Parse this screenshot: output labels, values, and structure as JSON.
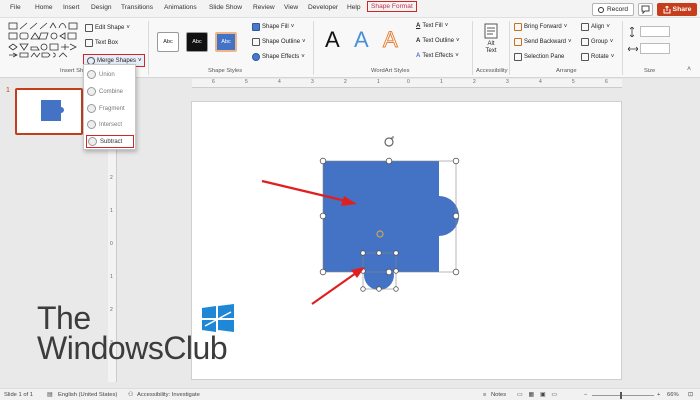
{
  "menubar": {
    "tabs": [
      "File",
      "Home",
      "Insert",
      "Design",
      "Transitions",
      "Animations",
      "Slide Show",
      "Review",
      "View",
      "Developer",
      "Help",
      "Shape Format"
    ],
    "active_tab": "Shape Format",
    "record_label": "Record",
    "share_label": "Share"
  },
  "ribbon": {
    "insert_shapes": {
      "edit_shape": "Edit Shape",
      "text_box": "Text Box",
      "merge_shapes": "Merge Shapes",
      "group_label": "Insert Sha"
    },
    "shape_styles": {
      "swatch_text": "Abc",
      "shape_fill": "Shape Fill",
      "shape_outline": "Shape Outline",
      "shape_effects": "Shape Effects",
      "group_label": "Shape Styles"
    },
    "wordart": {
      "glyph": "A",
      "text_fill": "Text Fill",
      "text_outline": "Text Outline",
      "text_effects": "Text Effects",
      "group_label": "WordArt Styles"
    },
    "accessibility": {
      "alt_text": "Alt Text",
      "group_label": "Accessibility"
    },
    "arrange": {
      "bring_forward": "Bring Forward",
      "send_backward": "Send Backward",
      "selection_pane": "Selection Pane",
      "align": "Align",
      "group": "Group",
      "rotate": "Rotate",
      "group_label": "Arrange"
    },
    "size": {
      "group_label": "Size"
    }
  },
  "merge_menu": {
    "items": [
      "Union",
      "Combine",
      "Fragment",
      "Intersect",
      "Subtract"
    ],
    "highlighted": "Subtract"
  },
  "slides_panel": {
    "slide_number": "1"
  },
  "ruler": {
    "h_numbers": [
      "6",
      "5",
      "4",
      "3",
      "2",
      "1",
      "0",
      "1",
      "2",
      "3",
      "4",
      "5",
      "6"
    ],
    "v_numbers": [
      "3",
      "2",
      "1",
      "0",
      "1",
      "2",
      "3"
    ]
  },
  "watermark": {
    "line1": "The",
    "line2": "WindowsClub"
  },
  "statusbar": {
    "slide_info": "Slide 1 of 1",
    "language": "English (United States)",
    "accessibility": "Accessibility: Investigate",
    "notes": "Notes",
    "zoom": "66%"
  },
  "colors": {
    "accent": "#c43e1c",
    "shape_fill": "#4472c4",
    "highlight_box": "#d0262a",
    "annotation_arrow": "#e02020"
  }
}
